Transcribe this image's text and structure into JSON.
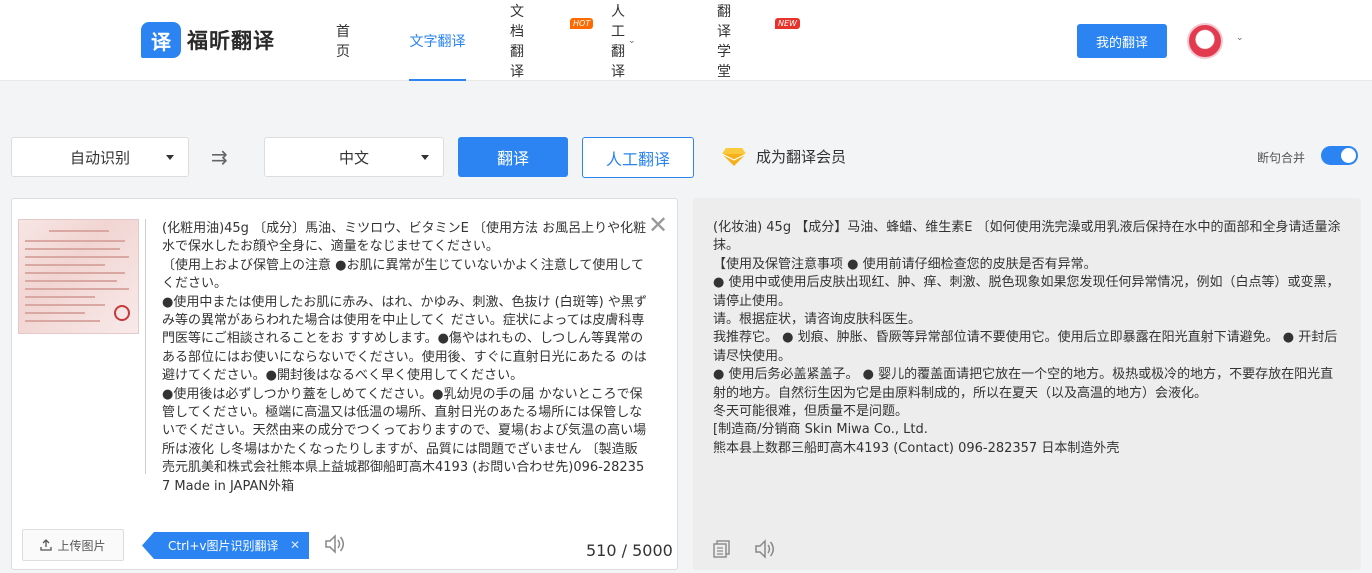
{
  "header": {
    "logo_mark": "译",
    "logo_text": "福昕翻译",
    "nav": [
      {
        "label": "首页"
      },
      {
        "label": "文字翻译"
      },
      {
        "label": "文档翻译",
        "badge": "HOT"
      },
      {
        "label": "人工翻译"
      },
      {
        "label": "翻译学堂",
        "badge": "NEW"
      }
    ],
    "my_translation": "我的翻译"
  },
  "toolbar": {
    "source_lang": "自动识别",
    "target_lang": "中文",
    "translate": "翻译",
    "human_translate": "人工翻译",
    "vip": "成为翻译会员",
    "merge": "断句合并",
    "merge_on": true
  },
  "source": {
    "text": "(化粧用油)45g 〔成分〕馬油、ミツロウ、ビタミンE 〔使用方法 お風呂上りや化粧水で保水したお顔や全身に、適量をなじませてください。\n〔使用上および保管上の注意 ●お肌に異常が生じていないかよく注意して使用してください。\n●使用中または使用したお肌に赤み、はれ、かゆみ、刺激、色抜け (白斑等) や黒ずみ等の異常があらわれた場合は使用を中止してく ださい。症状によっては皮膚科専門医等にご相談されることをお すすめします。●傷やはれもの、しつしん等異常のある部位にはお使いにならないでください。使用後、すぐに直射日光にあたる のは避けてください。●開封後はなるべく早く使用してください。\n●使用後は必ずしつかり蓋をしめてください。●乳幼児の手の届 かないところで保管してください。極端に高温又は低温の場所、直射日光のあたる場所には保管しないでください。天然由来の成分でつくっておりますので、夏場(および気温の高い場所は液化 し冬場はかたくなったりしますが、品質には問題でざいません 〔製造販売元肌美和株式会社熊本県上益城郡御船町高木4193 (お問い合わせ先)096-282357 Made in JAPAN外箱",
    "upload": "上传图片",
    "paste_tip": "Ctrl+v图片识别翻译",
    "count": "510 / 5000"
  },
  "target": {
    "text": "(化妆油) 45g 【成分】马油、蜂蜡、维生素E 〔如何使用洗完澡或用乳液后保持在水中的面部和全身请适量涂抹。\n【使用及保管注意事项 ● 使用前请仔细检查您的皮肤是否有异常。\n● 使用中或使用后皮肤出现红、肿、痒、刺激、脱色现象如果您发现任何异常情况，例如（白点等）或变黑，请停止使用。\n请。根据症状，请咨询皮肤科医生。\n我推荐它。 ● 划痕、肿胀、昏厥等异常部位请不要使用它。使用后立即暴露在阳光直射下请避免。 ● 开封后请尽快使用。\n● 使用后务必盖紧盖子。 ● 婴儿的覆盖面请把它放在一个空的地方。极热或极冷的地方，不要存放在阳光直射的地方。自然衍生因为它是由原料制成的，所以在夏天（以及高温的地方）会液化。\n冬天可能很难，但质量不是问题。\n[制造商/分销商 Skin Miwa Co., Ltd.\n熊本县上数郡三船町高木4193 (Contact) 096-282357 日本制造外壳"
  },
  "colors": {
    "accent": "#2b84f2",
    "hot": "#ff6a00",
    "new": "#e8332a"
  }
}
